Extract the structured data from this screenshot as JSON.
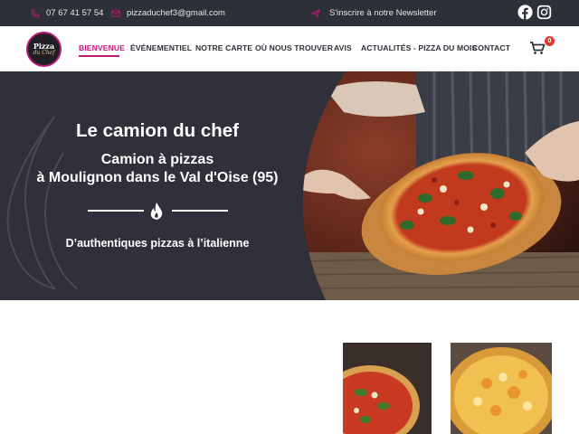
{
  "topbar": {
    "phone": "07 67 41 57 54",
    "email": "pizzaduchef3@gmail.com",
    "newsletter": "S'inscrire à notre Newsletter",
    "icons": [
      "phone-icon",
      "envelope-icon",
      "paper-plane-icon",
      "facebook-icon",
      "instagram-icon"
    ]
  },
  "logo": {
    "line1": "Pizza",
    "line2": "du Chef"
  },
  "nav": {
    "items": [
      {
        "label": "BIENVENUE",
        "active": true
      },
      {
        "label": "ÉVÉNEMENTIEL"
      },
      {
        "label": "NOTRE CARTE"
      },
      {
        "label": "OÙ NOUS TROUVER"
      },
      {
        "label": "AVIS"
      },
      {
        "label": "ACTUALITÉS - PIZZA DU MOIS"
      },
      {
        "label": "CONTACT"
      }
    ],
    "cart_count": "0"
  },
  "hero": {
    "title": "Le camion du chef",
    "subtitle_line1": "Camion à pizzas",
    "subtitle_line2": "à Moulignon dans le Val d'Oise (95)",
    "tagline": "D’authentiques pizzas à l’italienne"
  },
  "colors": {
    "accent": "#c2187a",
    "dark": "#2e3038",
    "badge": "#e23a2b"
  }
}
